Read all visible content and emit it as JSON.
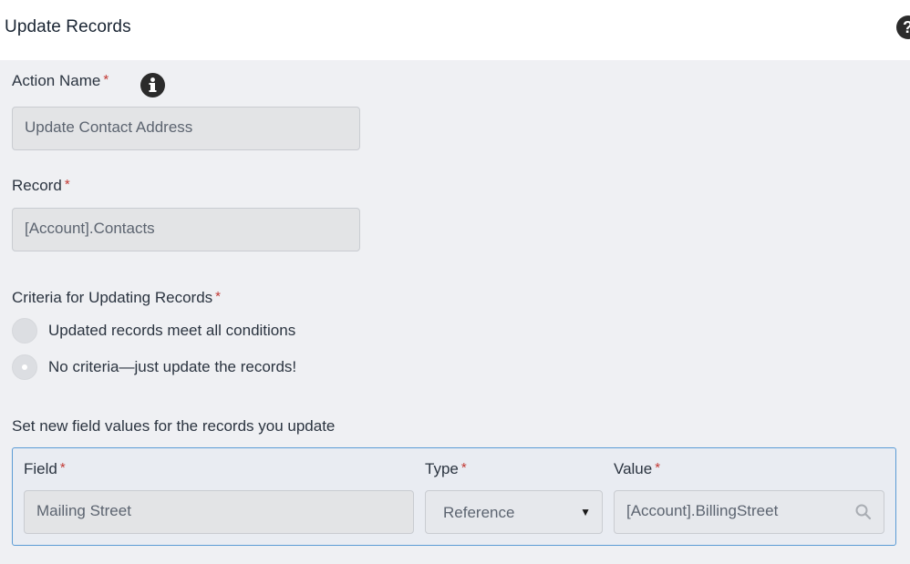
{
  "header": {
    "title": "Update Records",
    "help_icon": "help-icon"
  },
  "form": {
    "action_name": {
      "label": "Action Name",
      "required_mark": "*",
      "info_icon": "info-icon",
      "value": "Update Contact Address"
    },
    "record": {
      "label": "Record",
      "required_mark": "*",
      "value": "[Account].Contacts"
    },
    "criteria": {
      "label": "Criteria for Updating Records",
      "required_mark": "*",
      "options": [
        {
          "label": "Updated records meet all conditions",
          "selected": false
        },
        {
          "label": "No criteria—just update the records!",
          "selected": true
        }
      ]
    },
    "field_values": {
      "heading": "Set new field values for the records you update",
      "columns": {
        "field": "Field",
        "type": "Type",
        "value": "Value",
        "required_mark": "*"
      },
      "row": {
        "field": "Mailing Street",
        "type": "Reference",
        "value": "[Account].BillingStreet",
        "value_icon": "search-icon"
      }
    }
  },
  "colors": {
    "required": "#c23934",
    "panel_border": "#5b9bd5",
    "input_bg": "#e3e4e6"
  }
}
